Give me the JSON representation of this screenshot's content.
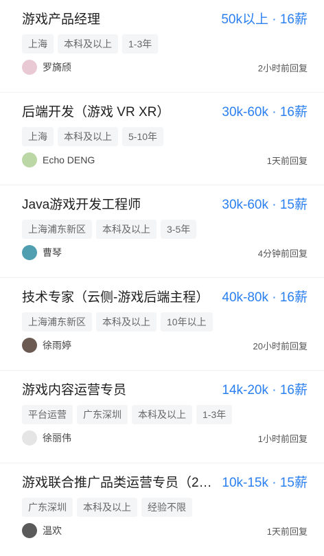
{
  "jobs": [
    {
      "title": "游戏产品经理",
      "salary": "50k以上 · 16薪",
      "tags": [
        "上海",
        "本科及以上",
        "1-3年"
      ],
      "recruiter": "罗旖颀",
      "reply": "2小时前回复",
      "avatar_color": "#e9c9d3"
    },
    {
      "title": "后端开发（游戏 VR XR）",
      "salary": "30k-60k · 16薪",
      "tags": [
        "上海",
        "本科及以上",
        "5-10年"
      ],
      "recruiter": "Echo DENG",
      "reply": "1天前回复",
      "avatar_color": "#bcd7a6"
    },
    {
      "title": "Java游戏开发工程师",
      "salary": "30k-60k · 15薪",
      "tags": [
        "上海浦东新区",
        "本科及以上",
        "3-5年"
      ],
      "recruiter": "曹琴",
      "reply": "4分钟前回复",
      "avatar_color": "#4f9fb0"
    },
    {
      "title": "技术专家（云侧-游戏后端主程）",
      "salary": "40k-80k · 16薪",
      "tags": [
        "上海浦东新区",
        "本科及以上",
        "10年以上"
      ],
      "recruiter": "徐雨婷",
      "reply": "20小时前回复",
      "avatar_color": "#6b5a52"
    },
    {
      "title": "游戏内容运营专员",
      "salary": "14k-20k · 16薪",
      "tags": [
        "平台运营",
        "广东深圳",
        "本科及以上",
        "1-3年"
      ],
      "recruiter": "徐丽伟",
      "reply": "1小时前回复",
      "avatar_color": "#e5e5e5"
    },
    {
      "title": "游戏联合推广品类运营专员（2…",
      "salary": "10k-15k · 15薪",
      "tags": [
        "广东深圳",
        "本科及以上",
        "经验不限"
      ],
      "recruiter": "温欢",
      "reply": "1天前回复",
      "avatar_color": "#5a5a5a"
    }
  ],
  "colors": {
    "salary": "#2a7ff0",
    "tag_bg": "#f4f5f7"
  }
}
